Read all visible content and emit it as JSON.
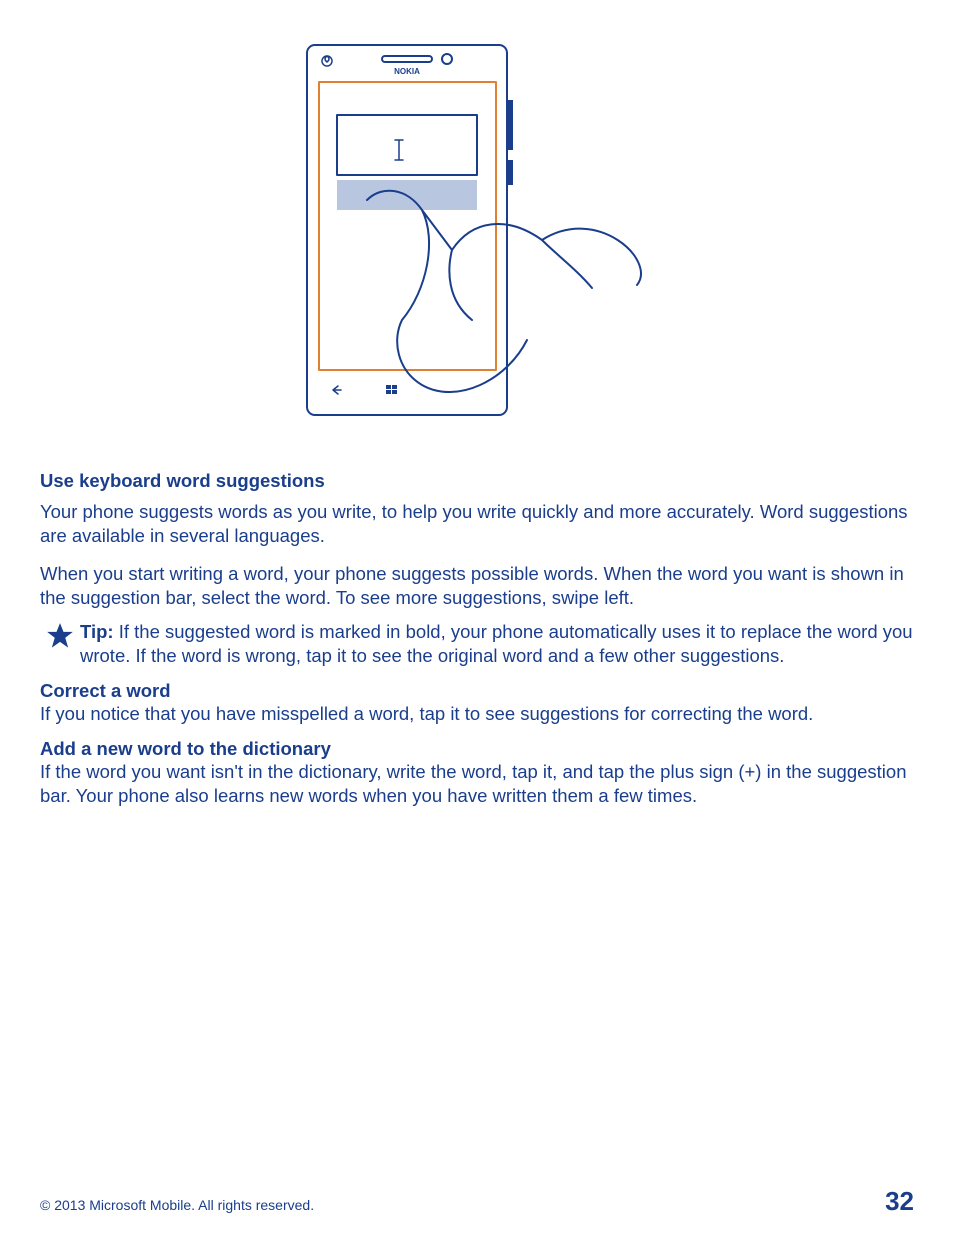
{
  "figure": {
    "brand": "NOKIA"
  },
  "section1": {
    "heading": "Use keyboard word suggestions",
    "para1": "Your phone suggests words as you write, to help you write quickly and more accurately. Word suggestions are available in several languages.",
    "para2": "When you start writing a word, your phone suggests possible words. When the word you want is shown in the suggestion bar, select the word. To see more suggestions, swipe left."
  },
  "tip": {
    "label": "Tip:",
    "body": " If the suggested word is marked in bold, your phone automatically uses it to replace the word you wrote. If the word is wrong, tap it to see the original word and a few other suggestions."
  },
  "section2": {
    "heading": "Correct a word",
    "body": "If you notice that you have misspelled a word, tap it to see suggestions for correcting the word."
  },
  "section3": {
    "heading": "Add a new word to the dictionary",
    "body": "If the word you want isn't in the dictionary, write the word, tap it, and tap the plus sign (+) in the suggestion bar. Your phone also learns new words when you have written them a few times."
  },
  "footer": {
    "copyright": "© 2013 Microsoft Mobile. All rights reserved.",
    "page": "32"
  }
}
